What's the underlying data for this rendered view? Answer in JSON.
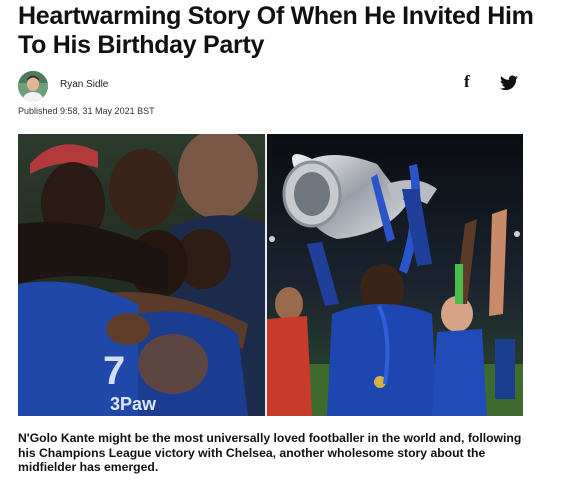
{
  "article": {
    "headline": "Heartwarming Story Of When He Invited Him To His Birthday Party",
    "author": "Ryan Sidle",
    "published": "Published 9:58, 31 May 2021 BST",
    "intro": "N'Golo Kante might be the most universally loved footballer in the world and, following his Champions League victory with Chelsea, another wholesome story about the midfielder has emerged."
  },
  "share": {
    "facebook_glyph": "f",
    "icons": [
      "facebook-icon",
      "twitter-icon"
    ]
  },
  "hero_image": {
    "left_panel": "players-hug-photo",
    "right_panel": "trophy-celebration-photo"
  },
  "colors": {
    "text": "#111111",
    "kit_blue": "#1b3f8f"
  }
}
